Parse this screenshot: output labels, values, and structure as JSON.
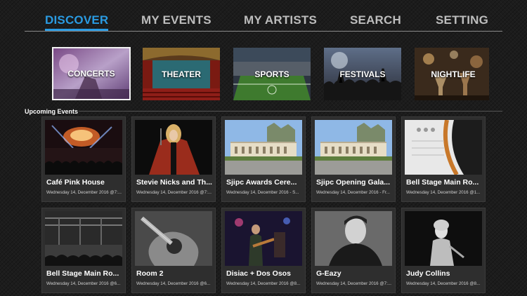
{
  "nav": {
    "tabs": [
      {
        "label": "DISCOVER",
        "active": true
      },
      {
        "label": "MY EVENTS",
        "active": false
      },
      {
        "label": "MY ARTISTS",
        "active": false
      },
      {
        "label": "SEARCH",
        "active": false
      },
      {
        "label": "SETTING",
        "active": false
      }
    ]
  },
  "categories": [
    {
      "label": "CONCERTS",
      "selected": true
    },
    {
      "label": "THEATER",
      "selected": false
    },
    {
      "label": "SPORTS",
      "selected": false
    },
    {
      "label": "FESTIVALS",
      "selected": false
    },
    {
      "label": "NIGHTLIFE",
      "selected": false
    }
  ],
  "upcoming": {
    "title": "Upcoming Events",
    "events": [
      {
        "title": "Café Pink House",
        "date": "Wednesday 14, December 2016 @7:..."
      },
      {
        "title": "Stevie Nicks and Th...",
        "date": "Wednesday 14, December 2016 @7:..."
      },
      {
        "title": "Sjipc Awards Cere...",
        "date": "Wednesday 14, December 2016 - S..."
      },
      {
        "title": "Sjipc Opening Gala...",
        "date": "Wednesday 14, December 2016 - Fr..."
      },
      {
        "title": "Bell Stage Main Ro...",
        "date": "Wednesday 14, December 2016 @1..."
      },
      {
        "title": "Bell Stage Main Ro...",
        "date": "Wednesday 14, December 2016 @6..."
      },
      {
        "title": "Room 2",
        "date": "Wednesday 14, December 2016 @6..."
      },
      {
        "title": "Disiac + Dos Osos",
        "date": "Wednesday 14, December 2016 @8..."
      },
      {
        "title": "G-Eazy",
        "date": "Wednesday 14, December 2016 @7:..."
      },
      {
        "title": "Judy Collins",
        "date": "Wednesday 14, December 2016 @8..."
      }
    ]
  },
  "colors": {
    "accent": "#2a9be2",
    "card": "#2e2e2e",
    "background": "#1c1c1c"
  }
}
